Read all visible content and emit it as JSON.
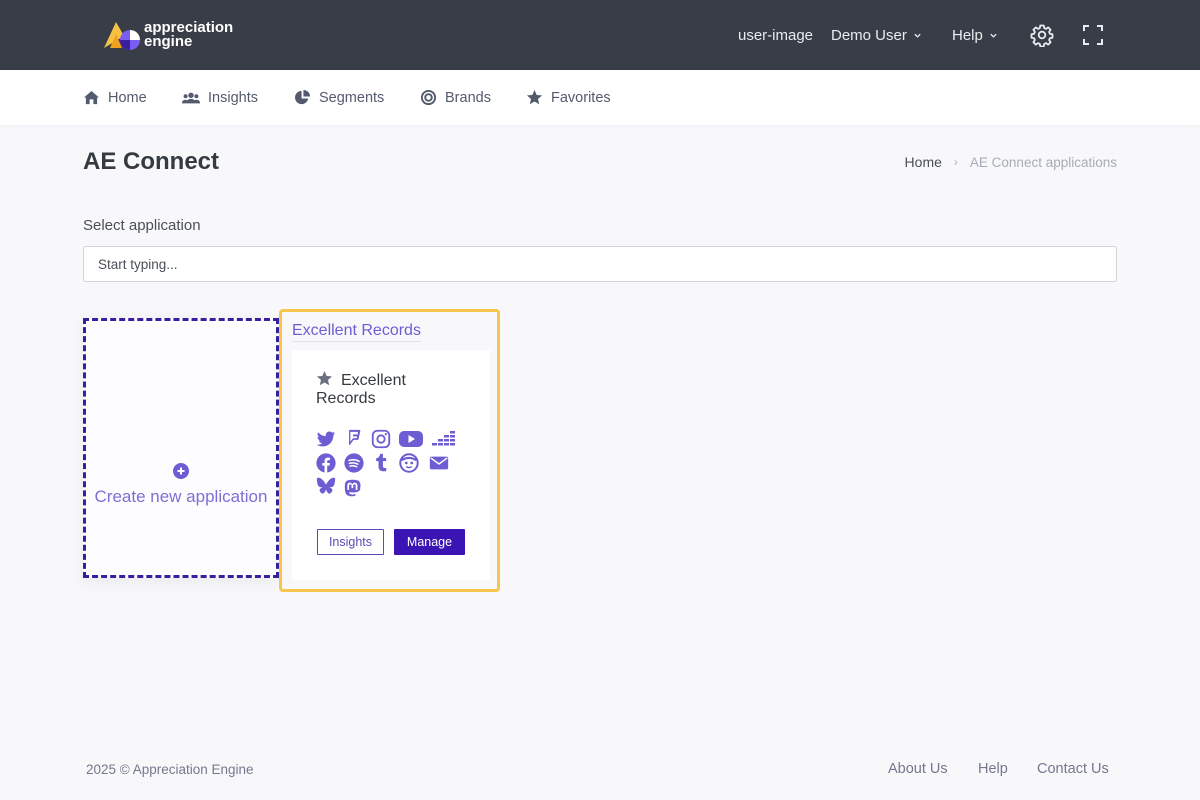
{
  "header": {
    "logo_text_line1": "appreciation",
    "logo_text_line2": "engine",
    "user_image_alt": "user-image",
    "user_name": "Demo User",
    "help_label": "Help"
  },
  "nav": {
    "items": [
      {
        "label": "Home",
        "icon": "home-icon"
      },
      {
        "label": "Insights",
        "icon": "users-icon"
      },
      {
        "label": "Segments",
        "icon": "pie-chart-icon"
      },
      {
        "label": "Brands",
        "icon": "target-icon"
      },
      {
        "label": "Favorites",
        "icon": "star-icon"
      }
    ]
  },
  "page": {
    "title": "AE Connect",
    "breadcrumb_home": "Home",
    "breadcrumb_sep": "›",
    "breadcrumb_current": "AE Connect applications"
  },
  "select": {
    "label": "Select application",
    "placeholder": "Start typing..."
  },
  "create_card": {
    "label": "Create new application"
  },
  "app_card": {
    "title": "Excellent Records",
    "name": "Excellent Records",
    "social_icons": [
      "twitter-icon",
      "foursquare-icon",
      "instagram-icon",
      "youtube-icon",
      "deezer-icon",
      "facebook-icon",
      "spotify-icon",
      "tumblr-icon",
      "napster-icon",
      "email-icon",
      "bluesky-icon",
      "mastodon-icon"
    ],
    "insights_button": "Insights",
    "manage_button": "Manage"
  },
  "footer": {
    "copyright": "2025 © Appreciation Engine",
    "links": [
      "About Us",
      "Help",
      "Contact Us"
    ]
  },
  "colors": {
    "header_bg": "#383d48",
    "accent": "#6c5dd3",
    "primary_button": "#3b14b4",
    "highlight_border": "#f8c64a"
  }
}
